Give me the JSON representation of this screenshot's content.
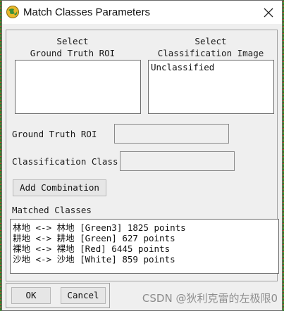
{
  "window": {
    "title": "Match Classes Parameters",
    "icon": "envi-globe-icon",
    "close_icon": "close-icon"
  },
  "ground_truth_roi_list": {
    "heading_line1": "Select",
    "heading_line2": "Ground Truth ROI",
    "items": []
  },
  "classification_image_list": {
    "heading_line1": "Select",
    "heading_line2": "Classification Image",
    "items": [
      "Unclassified"
    ]
  },
  "fields": {
    "ground_truth_roi_label": "Ground Truth ROI",
    "ground_truth_roi_value": "",
    "classification_class_label": "Classification Class",
    "classification_class_value": ""
  },
  "buttons": {
    "add_combination": "Add Combination",
    "ok": "OK",
    "cancel": "Cancel"
  },
  "matched_classes": {
    "label": "Matched Classes",
    "items": [
      "林地 <-> 林地 [Green3] 1825 points",
      "耕地 <-> 耕地 [Green] 627 points",
      "裸地 <-> 裸地 [Red] 6445 points",
      "沙地 <-> 沙地 [White] 859 points"
    ]
  },
  "watermark": "CSDN @狄利克雷的左极限0",
  "colors": {
    "dialog_background": "#efefef",
    "list_background": "#ffffff",
    "border": "#6e6e6e"
  }
}
